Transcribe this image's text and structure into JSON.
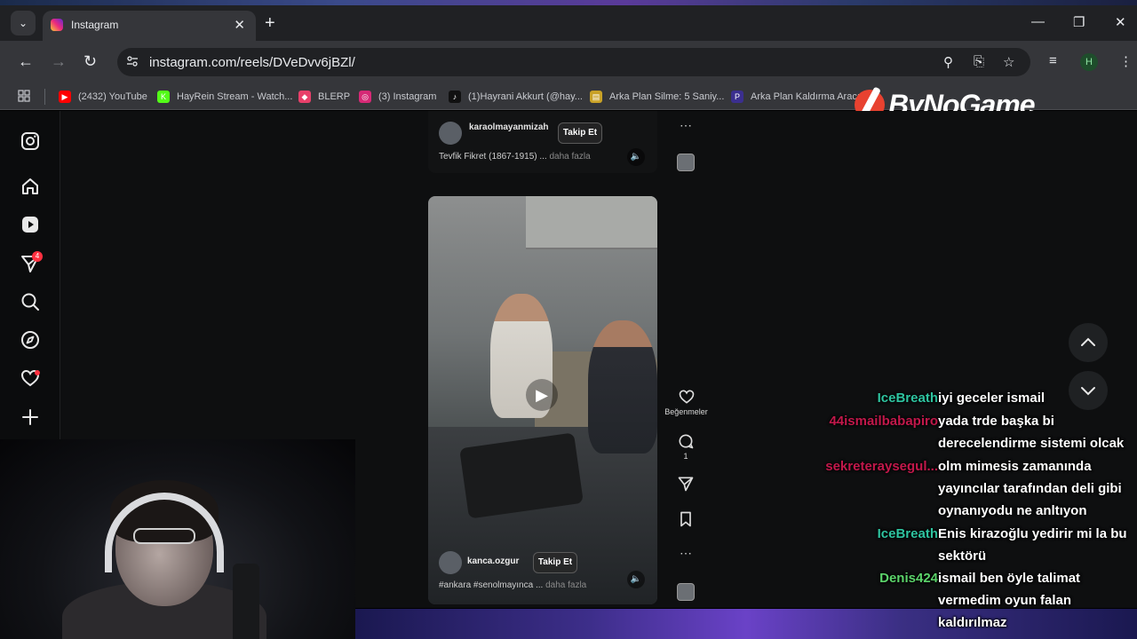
{
  "browser": {
    "tab_title": "Instagram",
    "url": "instagram.com/reels/DVeDvv6jBZl/",
    "profile_initial": "H",
    "bookmarks": [
      {
        "label": "(2432) YouTube",
        "color": "#ff0000"
      },
      {
        "label": "HayRein Stream - Watch...",
        "color": "#53fc18"
      },
      {
        "label": "BLERP",
        "color": "#e8406a"
      },
      {
        "label": "(3) Instagram",
        "color": "#d62976"
      },
      {
        "label": "(1)Hayrani Akkurt (@hay...",
        "color": "#111111"
      },
      {
        "label": "Arka Plan Silme: 5 Saniy...",
        "color": "#c9a227"
      },
      {
        "label": "Arka Plan Kaldırma Aracı...",
        "color": "#3b2f8f"
      }
    ]
  },
  "watermark": {
    "text": "ByNoGame"
  },
  "sidebar": {
    "messages_badge": "4"
  },
  "reel_prev": {
    "username": "karaolmayanmizah",
    "follow_label": "Takip Et",
    "caption": "Tevfik Fikret (1867-1915) ...",
    "more_label": "daha fazla"
  },
  "reel_current": {
    "username": "kanca.ozgur",
    "follow_label": "Takip Et",
    "caption": "#ankara #senolmayınca ...",
    "more_label": "daha fazla",
    "like_label": "Beğenmeler",
    "comment_count": "1"
  },
  "chat": [
    {
      "name": "IceBreath",
      "color": "#2ec4a0",
      "message": "iyi geceler ismail"
    },
    {
      "name": "44ismailbabapiro",
      "color": "#c2184b",
      "message": "yada trde başka bi derecelendirme sistemi olcak"
    },
    {
      "name": "sekreteraysegul...",
      "color": "#c2184b",
      "message": "olm mimesis zamanında yayıncılar tarafından deli gibi oynanıyodu ne anltıyon"
    },
    {
      "name": "IceBreath",
      "color": "#2ec4a0",
      "message": "Enis kirazoğlu yedirir mi la bu sektörü"
    },
    {
      "name": "Denis424",
      "color": "#5bd36a",
      "message": "ismail ben öyle talimat vermedim oyun falan kaldırılmaz"
    }
  ]
}
